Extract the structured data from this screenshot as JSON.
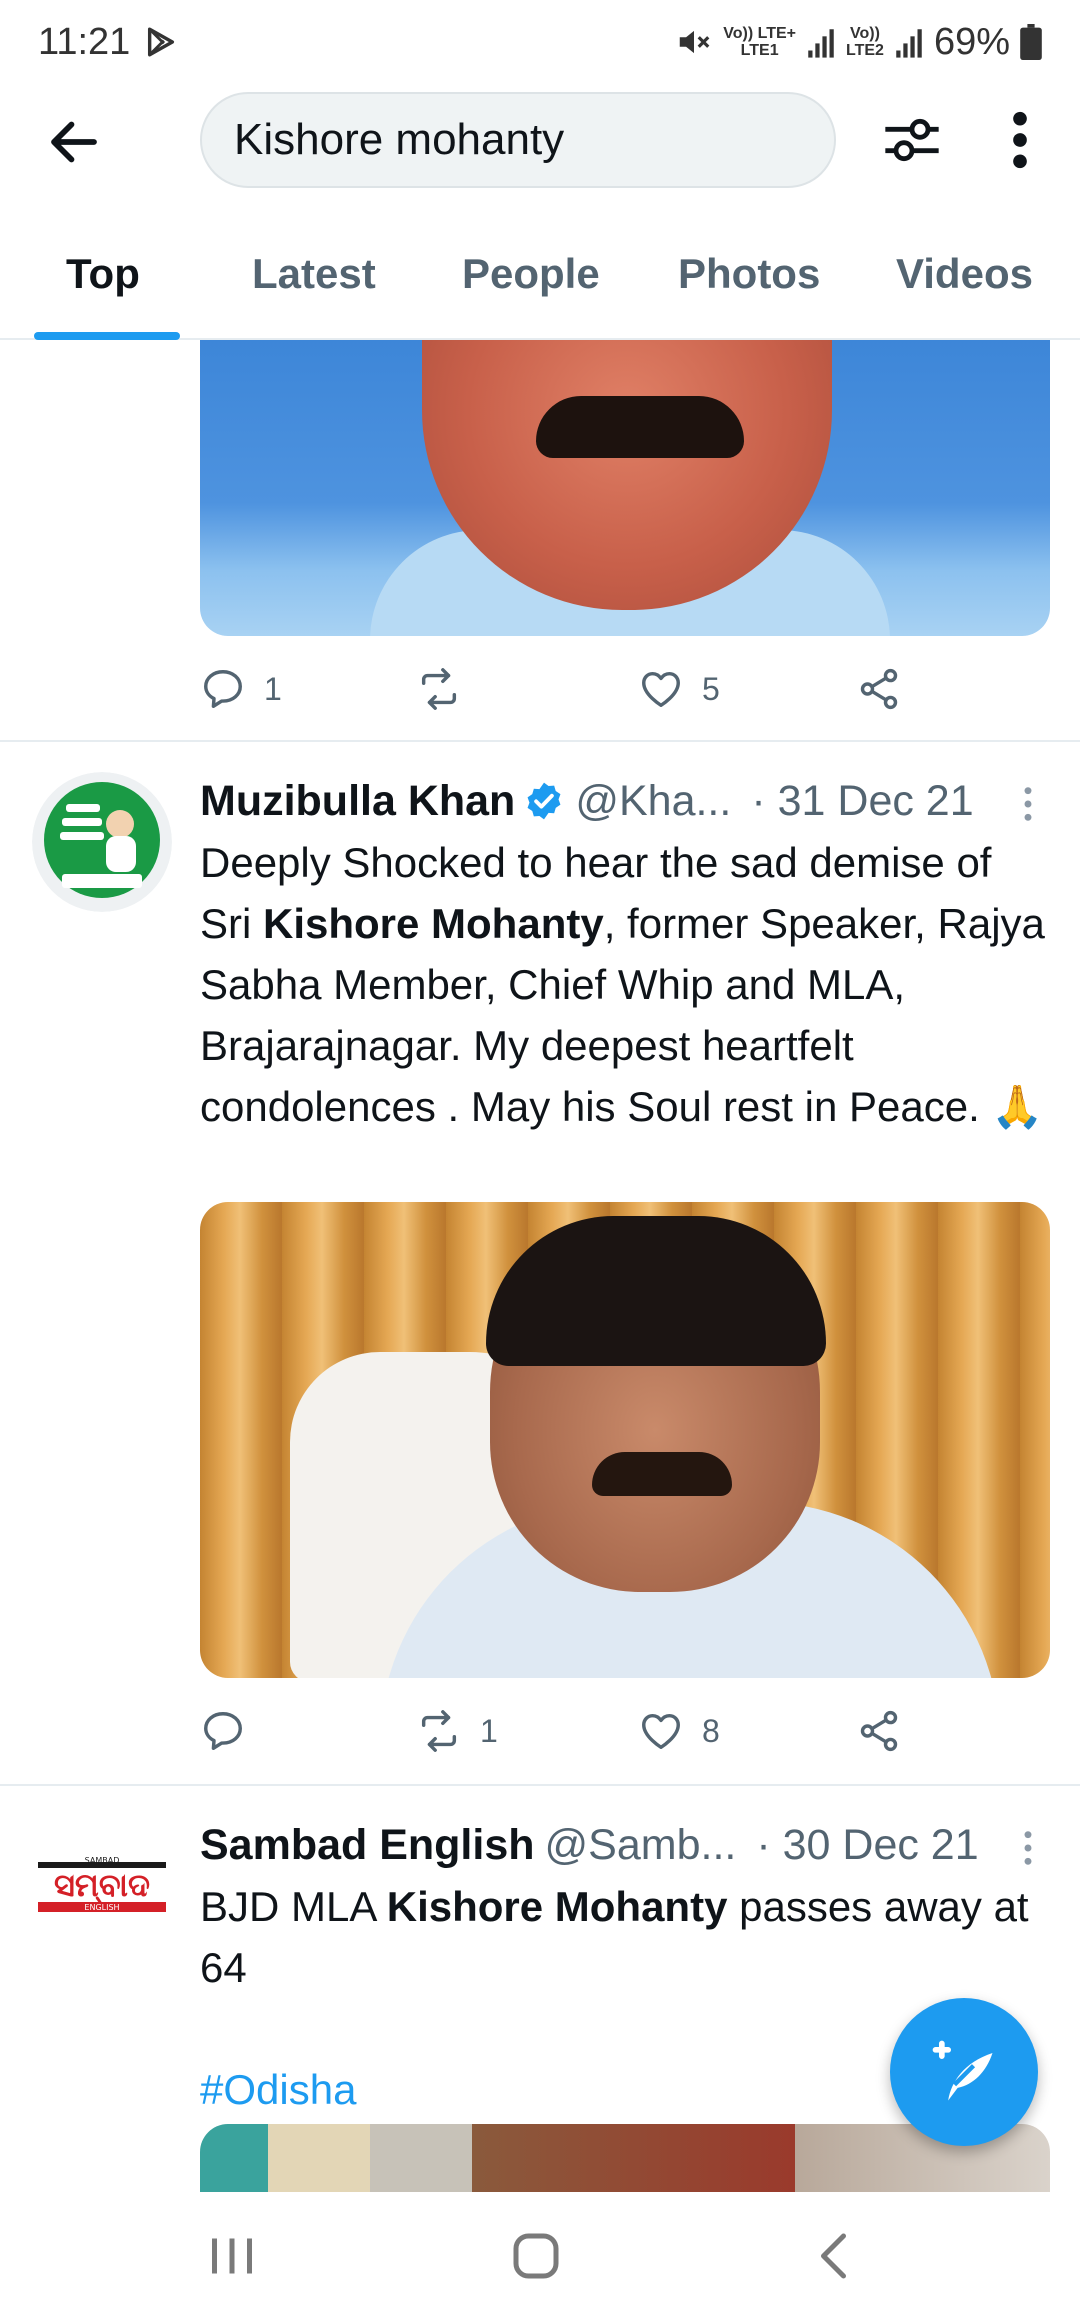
{
  "status_bar": {
    "time": "11:21",
    "net1_top": "Vo)) LTE+",
    "net1_bottom": "LTE1",
    "net2_top": "Vo))",
    "net2_bottom": "LTE2",
    "battery": "69%"
  },
  "search": {
    "query": "Kishore mohanty"
  },
  "tabs": [
    {
      "label": "Top",
      "active": true
    },
    {
      "label": "Latest"
    },
    {
      "label": "People"
    },
    {
      "label": "Photos"
    },
    {
      "label": "Videos"
    }
  ],
  "tweets": [
    {
      "reply_count": "1",
      "retweet_count": "",
      "like_count": "5"
    },
    {
      "author": "Muzibulla Khan",
      "verified": true,
      "handle": "@Kha...",
      "date": "· 31 Dec 21",
      "text_parts": [
        "Deeply Shocked to hear the sad demise of Sri ",
        "Kishore Mohanty",
        ", former Speaker, Rajya Sabha Member, Chief Whip and MLA, Brajarajnagar. My deepest heartfelt condolences . May his Soul rest in Peace. 🙏"
      ],
      "reply_count": "",
      "retweet_count": "1",
      "like_count": "8"
    },
    {
      "author": "Sambad English",
      "handle": "@Samb...",
      "date": "· 30 Dec 21",
      "text_parts": [
        "BJD MLA ",
        "Kishore Mohanty",
        " passes away at 64"
      ],
      "hashtag": "#Odisha",
      "avatar_logo_text": "ସମ୍ବାଦ",
      "avatar_logo_small": "SAMBAD",
      "avatar_logo_bottom": "ENGLISH"
    }
  ],
  "icons": {
    "back": "arrow-left-icon",
    "filter": "sliders-icon",
    "more": "more-vertical-icon",
    "compose": "compose-feather-icon"
  },
  "colors": {
    "accent": "#1d9bf0",
    "text": "#0f1419",
    "muted": "#536471"
  }
}
